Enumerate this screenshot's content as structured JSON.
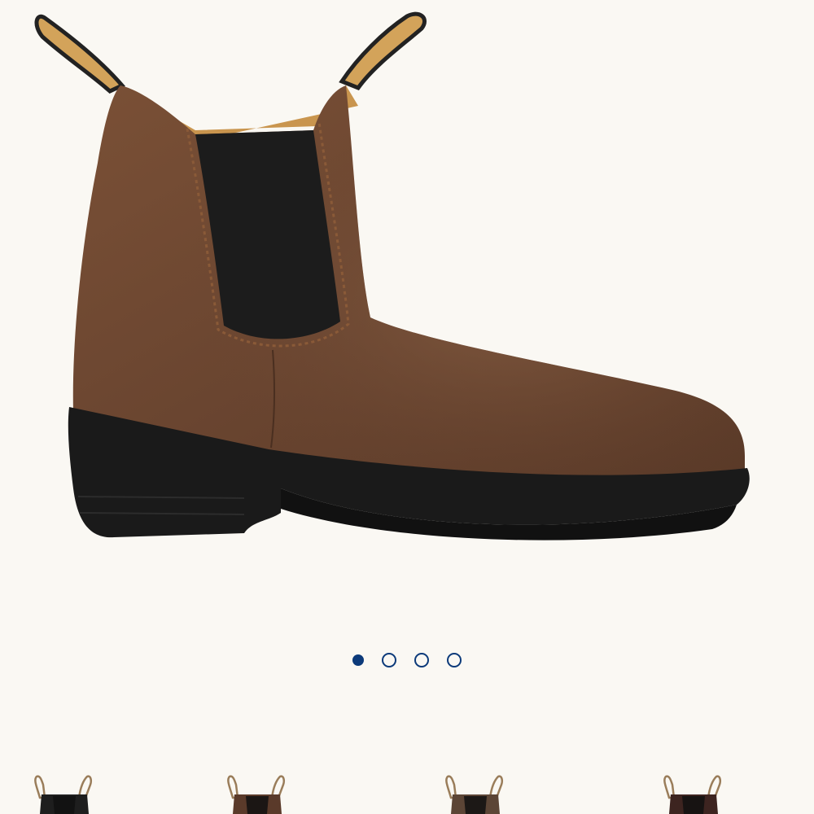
{
  "product": {
    "image_icon": "chelsea-boot-image",
    "colors": {
      "leather": "#6a4530",
      "leather_dark": "#4a2f20",
      "elastic": "#1c1c1c",
      "sole": "#1a1a1a",
      "pull_tab": "#d3a35a"
    }
  },
  "carousel": {
    "accent": "#0c3a7a",
    "active_index": 0,
    "slides": [
      "slide-1",
      "slide-2",
      "slide-3",
      "slide-4"
    ]
  },
  "thumbnails": [
    {
      "icon": "boot-thumbnail-icon",
      "color": "#1e1e1e"
    },
    {
      "icon": "boot-thumbnail-icon",
      "color": "#5a3a2a"
    },
    {
      "icon": "boot-thumbnail-icon",
      "color": "#5c4536"
    },
    {
      "icon": "boot-thumbnail-icon",
      "color": "#3d2420"
    }
  ]
}
